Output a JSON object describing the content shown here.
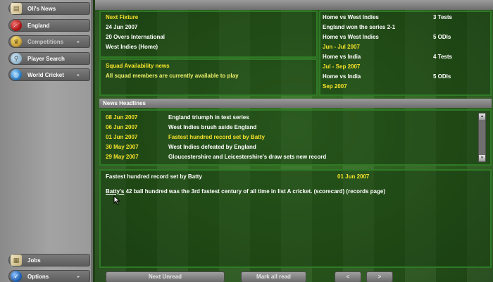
{
  "sidebar": {
    "items": [
      {
        "label": "Oli's News",
        "icon": "newspaper-icon",
        "has_submenu": false
      },
      {
        "label": "England",
        "icon": "cricket-ball-icon",
        "has_submenu": false
      },
      {
        "label": "Competitions",
        "icon": "trophy-icon",
        "has_submenu": true
      },
      {
        "label": "Player Search",
        "icon": "magnifier-icon",
        "has_submenu": false
      },
      {
        "label": "World Cricket",
        "icon": "globe-icon",
        "has_submenu": true
      }
    ],
    "bottom_items": [
      {
        "label": "Jobs",
        "icon": "jobs-icon"
      },
      {
        "label": "Options",
        "icon": "checkmark-icon",
        "has_submenu": true
      }
    ]
  },
  "next_fixture": {
    "heading": "Next Fixture",
    "date": "24 Jun 2007",
    "type": "20 Overs International",
    "opponent": "West Indies (Home)"
  },
  "squad": {
    "heading": "Squad Availability news",
    "message": "All squad members are currently available to play"
  },
  "tours": [
    {
      "text": "Home vs West Indies",
      "detail": "3 Tests",
      "color": "white"
    },
    {
      "text": "England won the series 2-1",
      "detail": "",
      "color": "white"
    },
    {
      "text": "Home vs West Indies",
      "detail": "5 ODIs",
      "color": "white"
    },
    {
      "text": "Jun - Jul 2007",
      "detail": "",
      "color": "yellow"
    },
    {
      "text": "Home vs India",
      "detail": "4 Tests",
      "color": "white"
    },
    {
      "text": "Jul - Sep 2007",
      "detail": "",
      "color": "yellow"
    },
    {
      "text": "Home vs India",
      "detail": "5 ODIs",
      "color": "white"
    },
    {
      "text": "Sep 2007",
      "detail": "",
      "color": "yellow"
    }
  ],
  "news": {
    "heading": "News Headlines",
    "rows": [
      {
        "date": "08 Jun 2007",
        "headline": "England triumph in test series",
        "selected": false
      },
      {
        "date": "06 Jun 2007",
        "headline": "West Indies brush aside England",
        "selected": false
      },
      {
        "date": "01 Jun 2007",
        "headline": "Fastest hundred record set by Batty",
        "selected": true
      },
      {
        "date": "30 May 2007",
        "headline": "West Indies defeated by England",
        "selected": false
      },
      {
        "date": "29 May 2007",
        "headline": "Gloucestershire and Leicestershire's draw sets new record",
        "selected": false
      }
    ]
  },
  "article": {
    "title": "Fastest hundred record set by Batty",
    "date": "01 Jun 2007",
    "link_name": "Batty's",
    "body": " 42 ball hundred was the 3rd fastest century of all time in list A cricket. (scorecard) (records page)"
  },
  "buttons": {
    "next_unread": "Next Unread",
    "mark_all_read": "Mark all read",
    "prev": "<",
    "next": ">"
  },
  "colors": {
    "sidebar": "#9a9a9a",
    "pitch": "#2c5e1e",
    "panel_border": "#2f7a26",
    "highlight_text": "#f6e32a",
    "body_text": "#ffffff"
  }
}
